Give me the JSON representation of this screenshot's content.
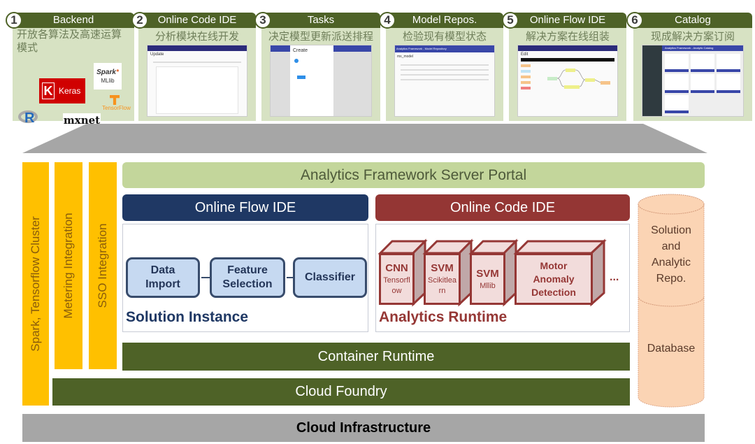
{
  "panels": [
    {
      "num": "1",
      "title": "Backend",
      "subtitle": "开放各算法及高速运算模式",
      "subtitle_line1": "开放各算法及高速运算",
      "subtitle_line2": "模式",
      "logos": [
        "Keras",
        "Spark MLlib",
        "TensorFlow",
        "R",
        "mxnet"
      ]
    },
    {
      "num": "2",
      "title": "Online Code IDE",
      "subtitle": "分析模块在线开发",
      "shot_title": "Update"
    },
    {
      "num": "3",
      "title": "Tasks",
      "subtitle": "决定模型更新派送排程",
      "shot_title": "Create"
    },
    {
      "num": "4",
      "title": "Model Repos.",
      "subtitle": "检验现有模型状态",
      "shot_title": "Analytics Framework - Model Repository",
      "shot_sub": "mx_model"
    },
    {
      "num": "5",
      "title": "Online Flow IDE",
      "subtitle": "解决方案在线组装",
      "shot_title": "Edit"
    },
    {
      "num": "6",
      "title": "Catalog",
      "subtitle": "现成解决方案订阅",
      "shot_title": "Analytics Framework - Analytic Catalog"
    }
  ],
  "left_bars": {
    "cluster": "Spark, Tensorflow Cluster",
    "metering": "Metering Integration",
    "sso": "SSO Integration"
  },
  "portal": "Analytics Framework Server Portal",
  "flow_ide": {
    "header": "Online Flow IDE",
    "nodes": [
      "Data Import",
      "Feature Selection",
      "Classifier"
    ],
    "node_lines": [
      [
        "Data",
        "Import"
      ],
      [
        "Feature",
        "Selection"
      ],
      [
        "Classifier"
      ]
    ],
    "caption": "Solution Instance"
  },
  "code_ide": {
    "header": "Online Code IDE",
    "modules": [
      {
        "title": "CNN",
        "sub": "Tensorfl ow"
      },
      {
        "title": "SVM",
        "sub": "Scikitlea rn"
      },
      {
        "title": "SVM",
        "sub": "Mllib"
      },
      {
        "title": "Motor Anomaly Detection",
        "sub": ""
      }
    ],
    "ellipsis": "...",
    "caption": "Analytics Runtime"
  },
  "repo": {
    "top": "Solution and Analytic Repo.",
    "bottom": "Database"
  },
  "container_runtime": "Container Runtime",
  "cloud_foundry": "Cloud Foundry",
  "cloud_infrastructure": "Cloud Infrastructure",
  "colors": {
    "panel_green": "#4e6227",
    "panel_bg": "#d7e2c3",
    "portal": "#c3d69b",
    "flow_header": "#1f3864",
    "code_header": "#943634",
    "yellow": "#ffc000",
    "infra_gray": "#a6a6a6",
    "repo": "#fbd4b4"
  }
}
